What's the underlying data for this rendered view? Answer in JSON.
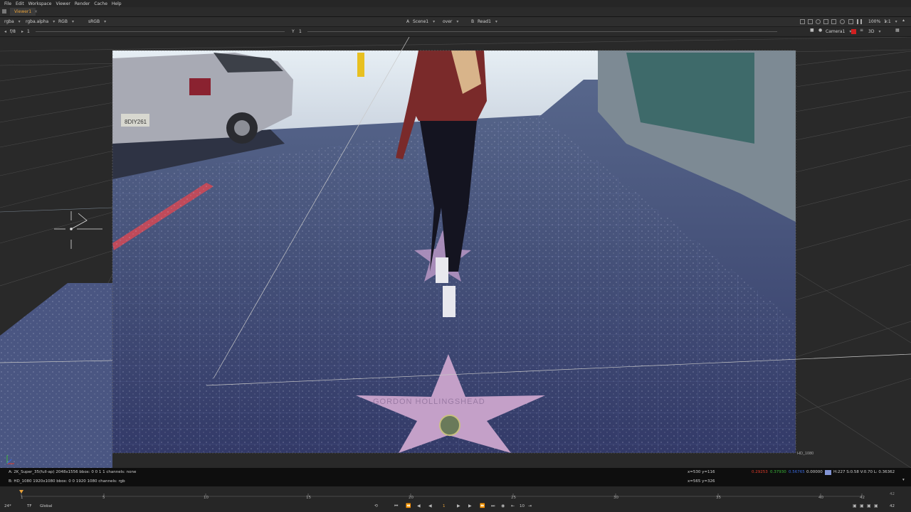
{
  "menu": [
    "File",
    "Edit",
    "Workspace",
    "Viewer",
    "Render",
    "Cache",
    "Help"
  ],
  "viewer_tab": "Viewer1",
  "toolbar": {
    "channels": "rgba",
    "alpha": "rgba.alpha",
    "colorspace": "RGB",
    "lut": "sRGB",
    "input_a_label": "A",
    "input_a": "Scene1",
    "composite": "over",
    "input_b_label": "B",
    "input_b": "Read1",
    "zoom": "100%",
    "ratio": "1:1",
    "gain_label": "f/8",
    "gain_value": "1",
    "gamma_label": "Y",
    "gamma_value": "1",
    "camera": "Camera1",
    "mode": "3D"
  },
  "viewer": {
    "format_label": "HD_1080",
    "star_text": "GORDON HOLLINGSHEAD",
    "plate_text": "8DIY261"
  },
  "info": {
    "a_line": "A:  2K_Super_35(full-ap) 2048x1556  bbox: 0 0 1 1 channels: none",
    "b_line": "B:  HD_1080 1920x1080  bbox: 0 0 1920 1080 channels: rgb",
    "a_coords": "x=530 y=116",
    "b_coords": "x=565 y=326",
    "r": "0.29253",
    "g": "0.37930",
    "b": "0.56765",
    "a": "0.00000",
    "hsvl": "H:227 S:0.58 V:0.70  L: 0.36362",
    "colors": {
      "r": "#e03a2a",
      "g": "#3ab83a",
      "b": "#3a6ae0",
      "swatch": "#8294d4",
      "accent": "#e8a23a"
    }
  },
  "timeline": {
    "ticks": [
      "1",
      "5",
      "10",
      "15",
      "20",
      "25",
      "30",
      "35",
      "40",
      "42"
    ],
    "end_frame": "42",
    "fps": "24*",
    "tf": "TF",
    "scope": "Global",
    "current_frame": "1",
    "frame_end_field": "42",
    "inc": "10"
  }
}
